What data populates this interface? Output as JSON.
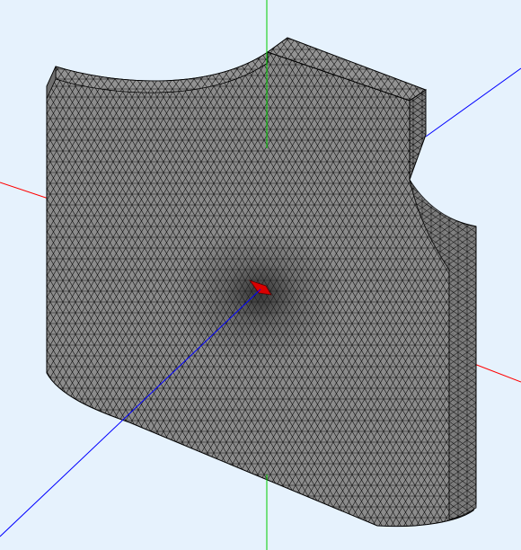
{
  "viewer": {
    "background": "#e6f2fd",
    "mesh_fill": "#8c8c8c",
    "mesh_edge": "#000000",
    "axis_colors": {
      "x": "#ff0000",
      "y": "#00cc00",
      "z": "#0000ff"
    },
    "highlight_color": "#d90000"
  }
}
